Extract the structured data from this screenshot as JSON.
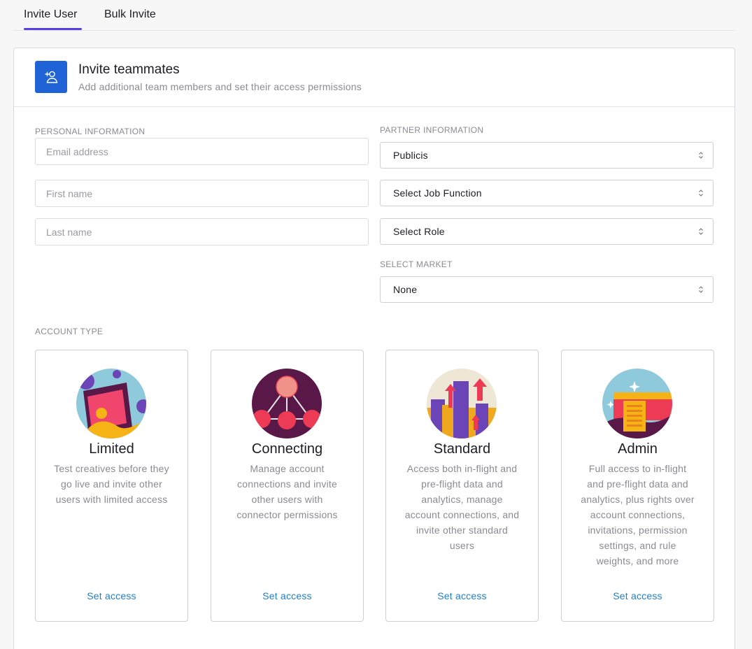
{
  "tabs": [
    {
      "label": "Invite User",
      "active": true
    },
    {
      "label": "Bulk Invite",
      "active": false
    }
  ],
  "header": {
    "icon": "add-user-icon",
    "title": "Invite teammates",
    "subtitle": "Add additional team members and set their access permissions"
  },
  "personal": {
    "label": "PERSONAL INFORMATION",
    "email_placeholder": "Email address",
    "first_name_placeholder": "First name",
    "last_name_placeholder": "Last name"
  },
  "partner": {
    "label": "PARTNER INFORMATION",
    "partner_value": "Publicis",
    "job_function_value": "Select Job Function",
    "role_value": "Select Role"
  },
  "market": {
    "label": "SELECT MARKET",
    "value": "None"
  },
  "account_type": {
    "label": "ACCOUNT TYPE",
    "cards": [
      {
        "title": "Limited",
        "description": "Test creatives before they go live and invite other users with limited access",
        "link": "Set access",
        "illustration": "limited-illustration-icon"
      },
      {
        "title": "Connecting",
        "description": "Manage account connections and invite other users with connector permissions",
        "link": "Set access",
        "illustration": "connecting-illustration-icon"
      },
      {
        "title": "Standard",
        "description": "Access both in-flight and pre-flight data and analytics, manage account connections, and invite other standard users",
        "link": "Set access",
        "illustration": "standard-illustration-icon"
      },
      {
        "title": "Admin",
        "description": "Full access to in-flight and pre-flight data and analytics, plus rights over account connections, invitations, permission settings, and rule weights, and more",
        "link": "Set access",
        "illustration": "admin-illustration-icon"
      }
    ]
  },
  "colors": {
    "accent": "#5a3fe0",
    "primary_blue": "#1f63d6",
    "link": "#1f7fd0"
  }
}
